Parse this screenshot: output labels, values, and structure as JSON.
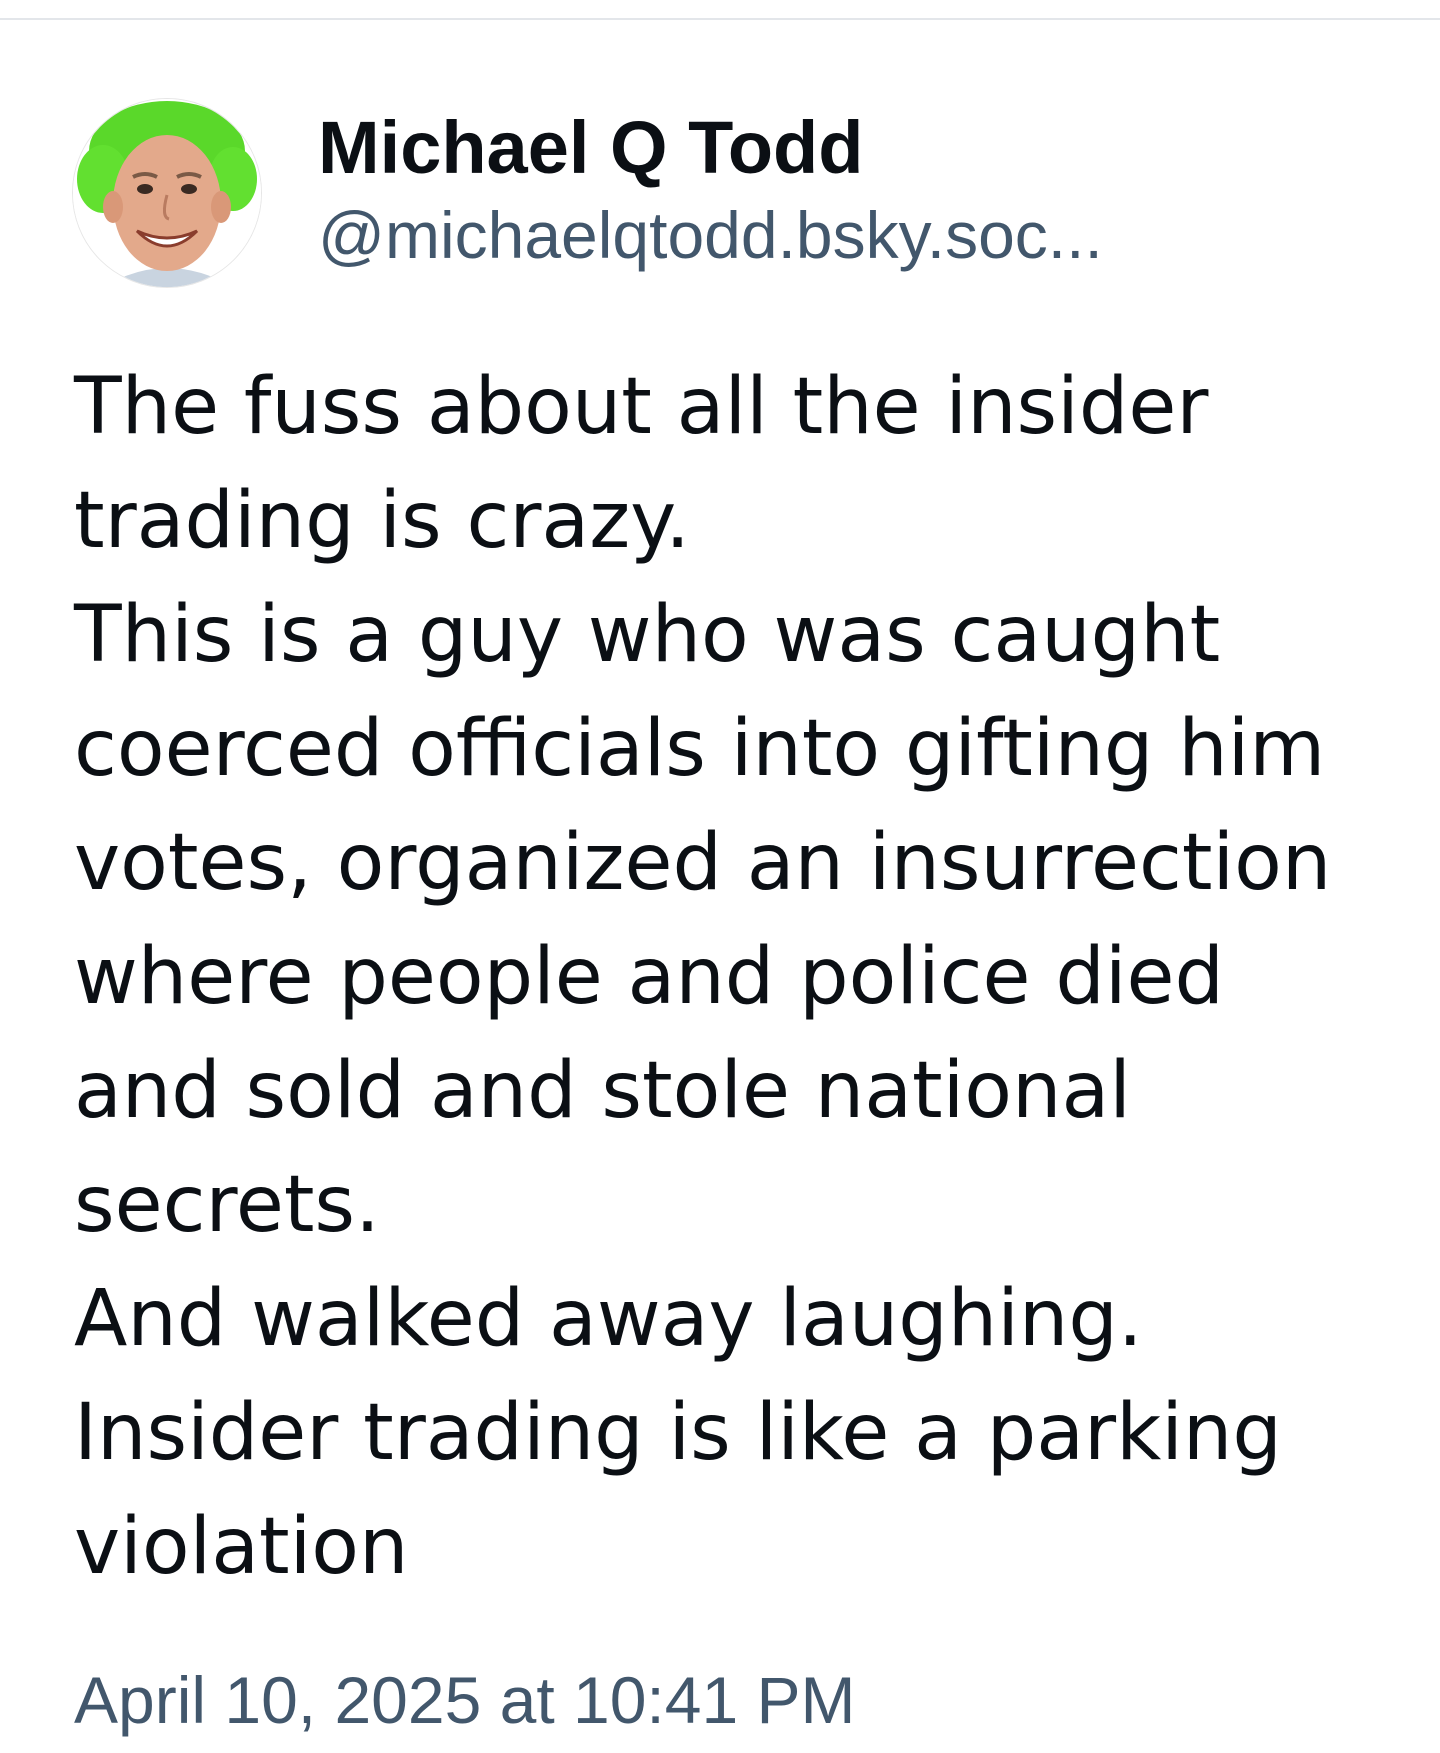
{
  "post": {
    "author": {
      "display_name": "Michael Q Todd",
      "handle": "@michaelqtodd.bsky.soc...",
      "avatar_icon": "profile-photo-avatar"
    },
    "text": "The fuss about all the insider trading is crazy.\nThis is a guy who was caught coerced officials into gifting him votes, organized an insurrection where people and police died and sold and stole national secrets.\nAnd walked away laughing.\nInsider trading is like a parking violation",
    "timestamp": "April 10, 2025 at 10:41 PM"
  },
  "colors": {
    "text_primary": "#0b0f14",
    "text_secondary": "#42576c",
    "divider": "#e3e6ea"
  }
}
